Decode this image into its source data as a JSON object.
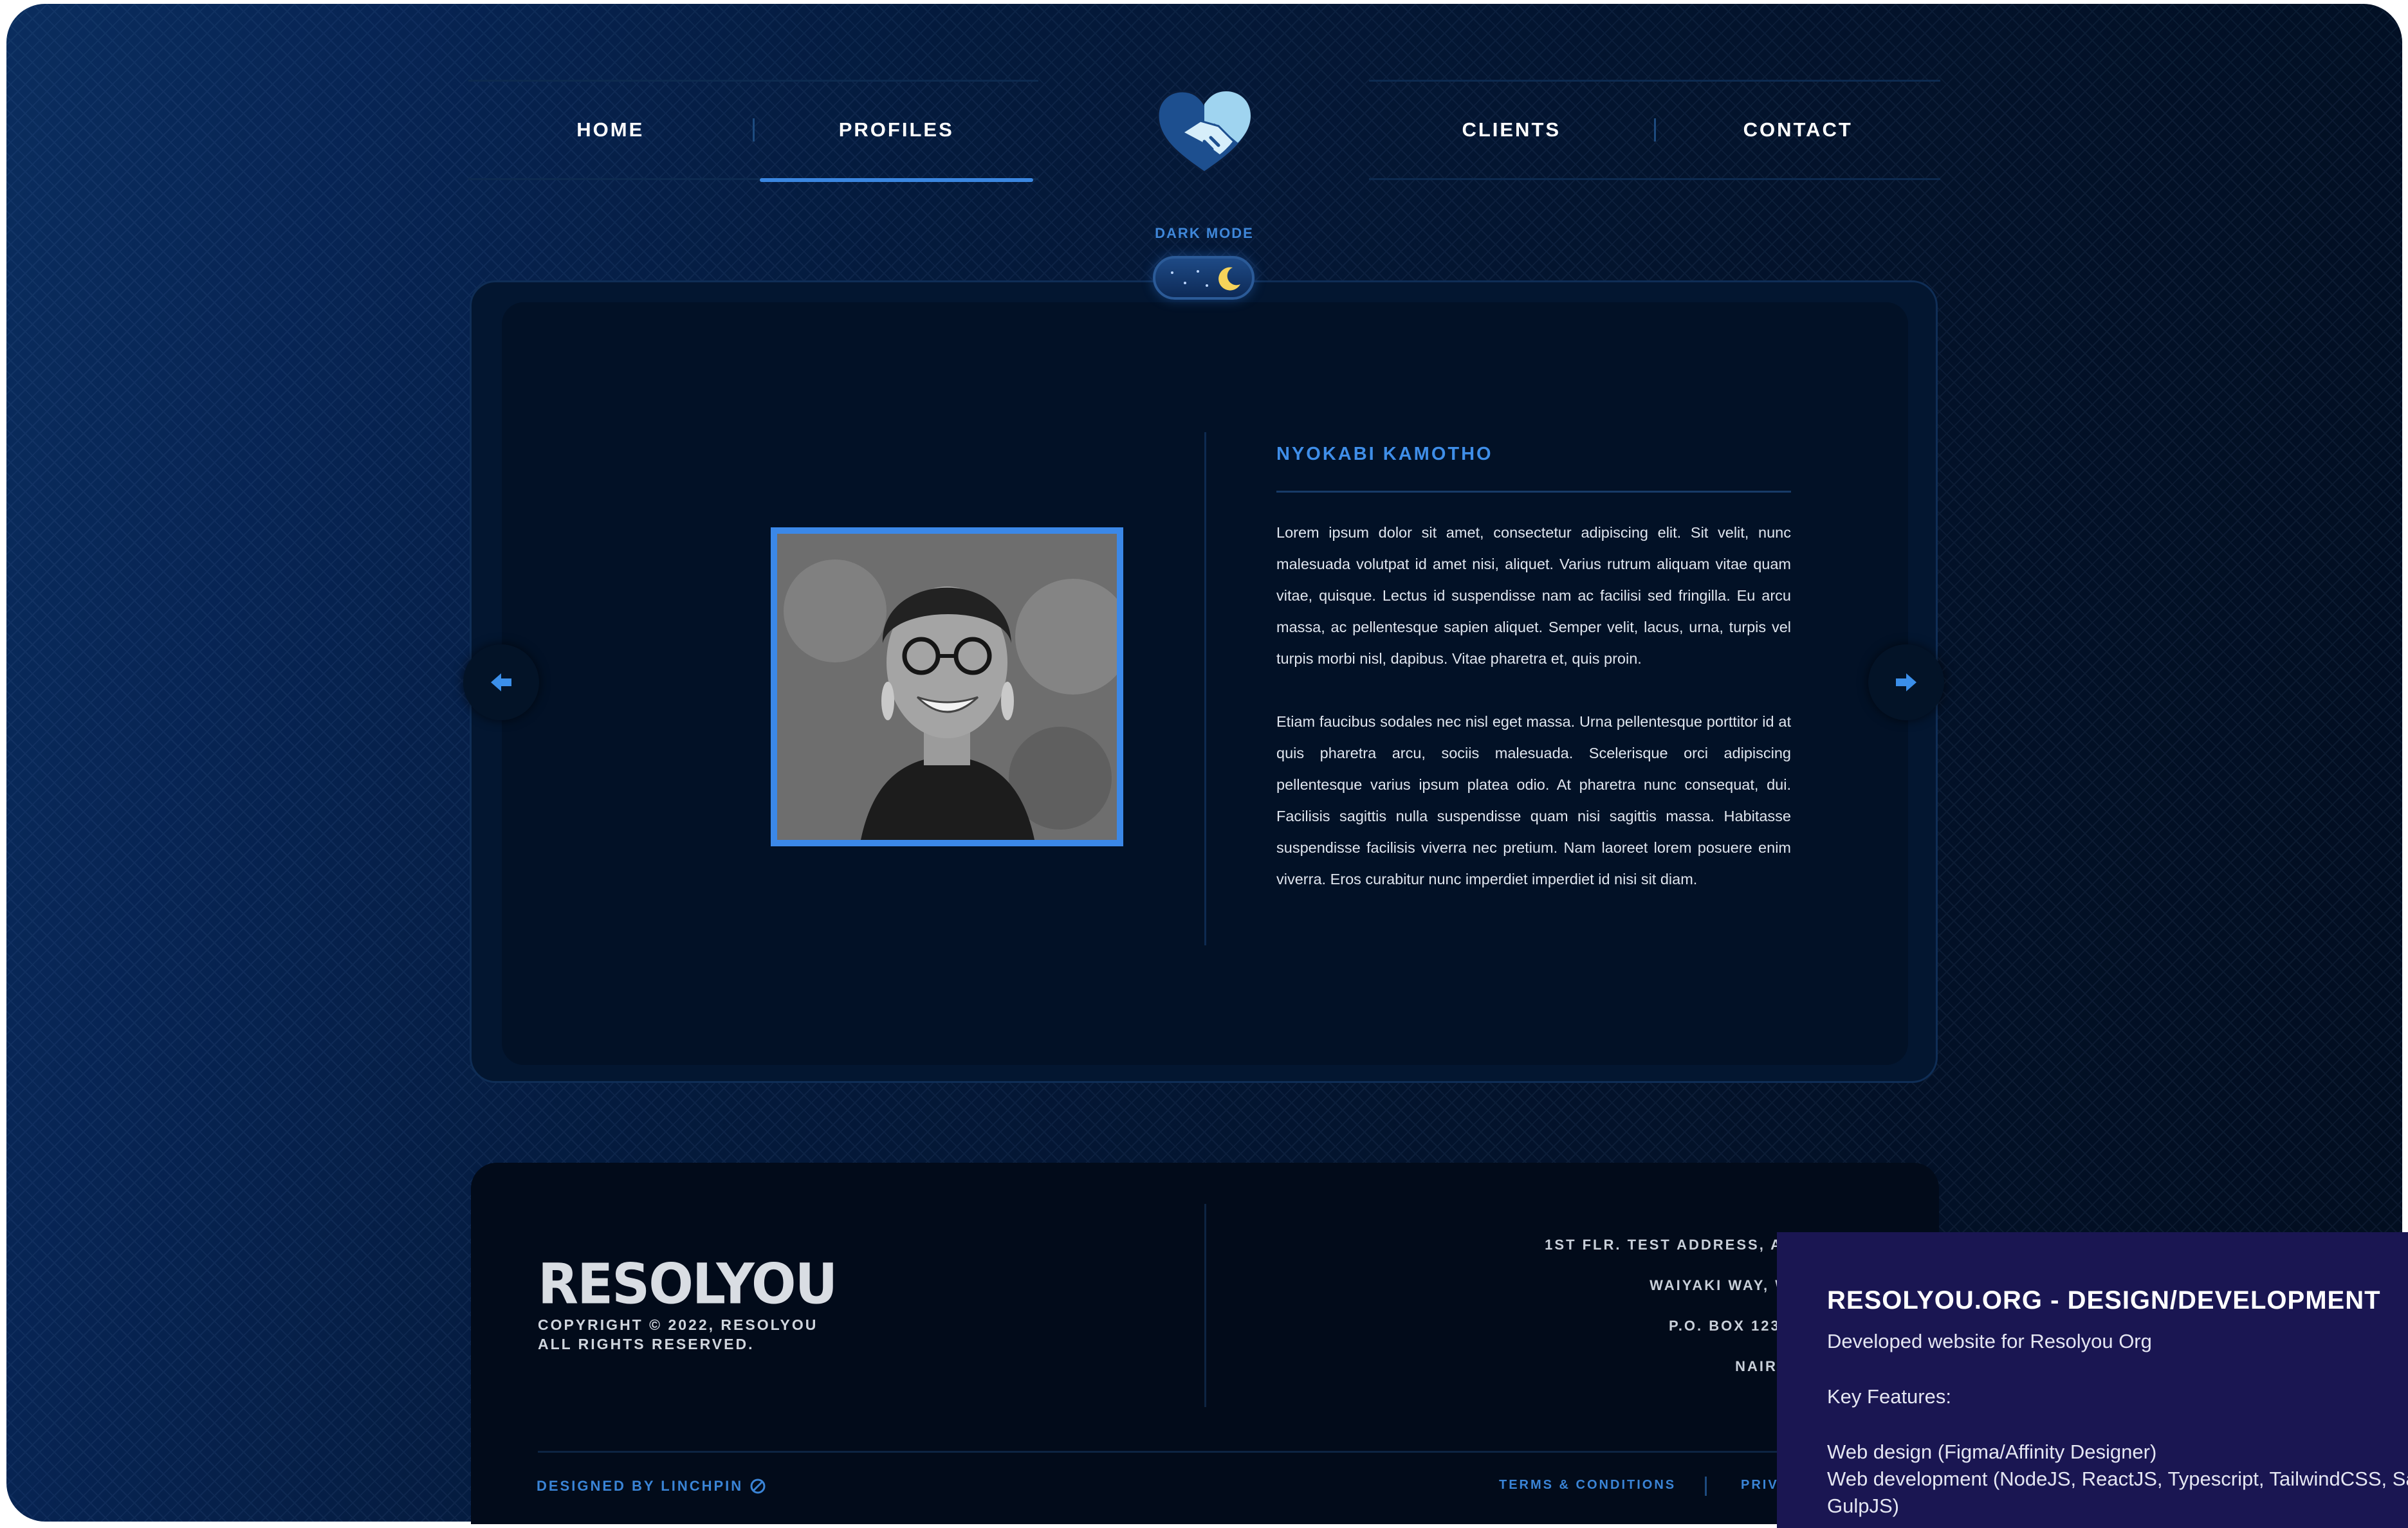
{
  "nav": {
    "home": "HOME",
    "profiles": "PROFILES",
    "clients": "CLIENTS",
    "contact": "CONTACT",
    "logo_icon": "handshake-heart-icon"
  },
  "dark_mode": {
    "label": "DARK MODE",
    "state": "on"
  },
  "profile": {
    "name": "NYOKABI KAMOTHO",
    "paragraph_1": "Lorem ipsum dolor sit amet, consectetur adipiscing elit. Sit velit, nunc malesuada volutpat id amet nisi, aliquet. Varius rutrum aliquam vitae quam vitae, quisque. Lectus id suspendisse nam ac facilisi sed fringilla. Eu arcu massa, ac pellentesque sapien aliquet. Semper velit, lacus, urna, turpis vel turpis morbi nisl, dapibus. Vitae pharetra et, quis proin.",
    "paragraph_2": "Etiam faucibus sodales nec nisl eget massa. Urna pellentesque porttitor id at quis pharetra arcu, sociis malesuada. Scelerisque orci adipiscing pellentesque varius ipsum platea odio. At pharetra nunc consequat, dui. Facilisis sagittis nulla suspendisse quam nisi sagittis massa. Habitasse suspendisse facilisis viverra nec pretium. Nam laoreet lorem posuere enim viverra. Eros curabitur nunc imperdiet imperdiet id nisi sit diam."
  },
  "carousel": {
    "prev_icon": "arrow-left-icon",
    "next_icon": "arrow-right-icon"
  },
  "footer": {
    "brand": "RESOLYOU",
    "copyright_1": "COPYRIGHT © 2022, RESOLYOU",
    "copyright_2": "ALL RIGHTS RESERVED.",
    "address": [
      "1ST FLR. TEST ADDRESS, A",
      "WAIYAKI WAY, W",
      "P.O. BOX 1234",
      "NAIRO"
    ],
    "designed_by": "DESIGNED BY LINCHPIN",
    "terms": "TERMS & CONDITIONS",
    "privacy": "PRIV"
  },
  "overlay": {
    "title": "RESOLYOU.ORG - DESIGN/DEVELOPMENT",
    "description": "Developed website for Resolyou Org",
    "key_features": "Key Features:",
    "web_design": "Web design (Figma/Affinity Designer)",
    "web_development": "Web development (NodeJS, ReactJS, Typescript, TailwindCSS, Sa",
    "web_development_cont": "GulpJS)"
  },
  "colors": {
    "accent": "#3b88e8",
    "background": "#03132c",
    "overlay": "#1a1652"
  }
}
